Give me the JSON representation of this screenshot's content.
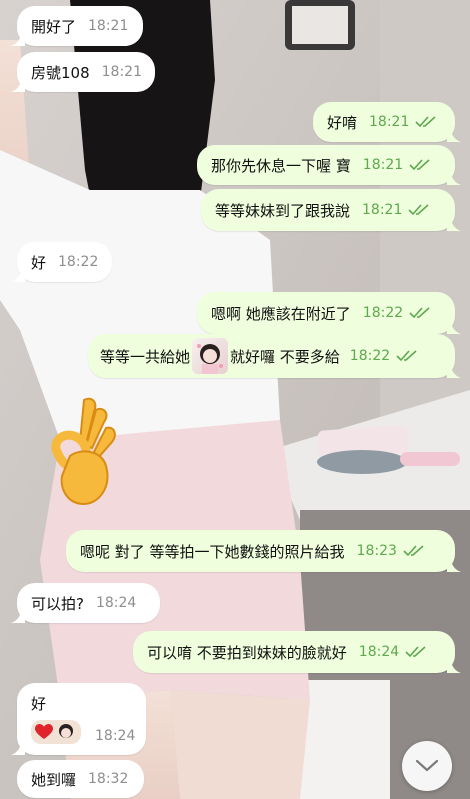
{
  "messages": [
    {
      "dir": "in",
      "text": "開好了",
      "time": "18:21"
    },
    {
      "dir": "in",
      "text": "房號108",
      "time": "18:21"
    },
    {
      "dir": "out",
      "text": "好唷",
      "time": "18:21"
    },
    {
      "dir": "out",
      "text": "那你先休息一下喔 寶",
      "time": "18:21"
    },
    {
      "dir": "out",
      "text": "等等妹妹到了跟我說",
      "time": "18:21"
    },
    {
      "dir": "in",
      "text": "好",
      "time": "18:22"
    },
    {
      "dir": "out",
      "text": "嗯啊 她應該在附近了",
      "time": "18:22"
    },
    {
      "dir": "out",
      "text_before": "等等一共給她",
      "text_after": "就好囉 不要多給",
      "time": "18:22"
    },
    {
      "dir": "out",
      "text": "嗯呢 對了 等等拍一下她數錢的照片給我",
      "time": "18:23"
    },
    {
      "dir": "in",
      "text": "可以拍?",
      "time": "18:24"
    },
    {
      "dir": "out",
      "text": "可以唷 不要拍到妹妹的臉就好",
      "time": "18:24"
    },
    {
      "dir": "in",
      "text": "好",
      "time": "18:24"
    },
    {
      "dir": "in",
      "text": "她到囉",
      "time": "18:32"
    }
  ],
  "icons": {
    "read_receipt": "double-check-icon",
    "ok_sticker": "ok-hand-icon",
    "heart": "heart-icon",
    "scroll_down": "chevron-down-icon"
  },
  "colors": {
    "incoming_bubble": "#ffffff",
    "outgoing_bubble": "#effedd",
    "outgoing_time": "#5ea84d",
    "incoming_time": "#8e8e8e"
  }
}
